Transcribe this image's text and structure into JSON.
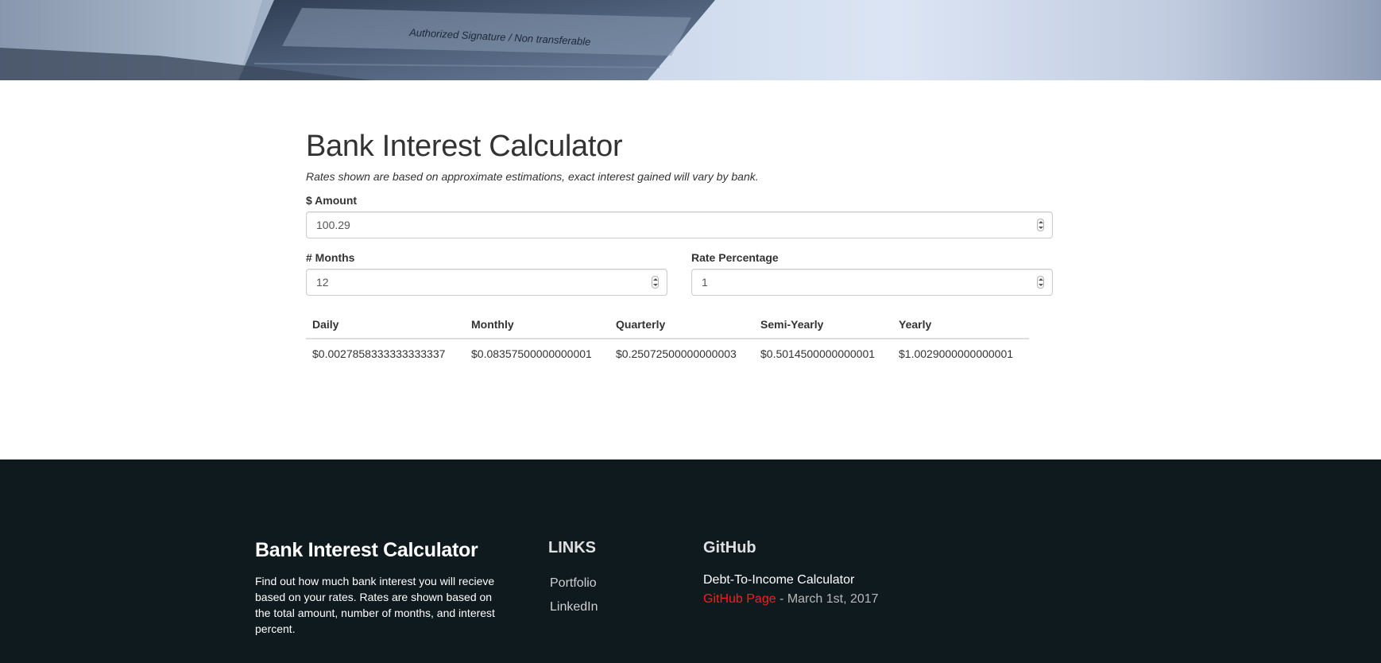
{
  "hero": {
    "card_text": "Authorized Signature / Non transferable"
  },
  "main": {
    "title": "Bank Interest Calculator",
    "subtitle": "Rates shown are based on approximate estimations, exact interest gained will vary by bank.",
    "amount": {
      "label": "$ Amount",
      "value": "100.29"
    },
    "months": {
      "label": "# Months",
      "value": "12"
    },
    "rate": {
      "label": "Rate Percentage",
      "value": "1"
    },
    "table": {
      "headers": [
        "Daily",
        "Monthly",
        "Quarterly",
        "Semi-Yearly",
        "Yearly"
      ],
      "values": [
        "$0.0027858333333333337",
        "$0.08357500000000001",
        "$0.25072500000000003",
        "$0.5014500000000001",
        "$1.0029000000000001"
      ]
    }
  },
  "footer": {
    "about": {
      "title": "Bank Interest Calculator",
      "description": "Find out how much bank interest you will recieve based on your rates. Rates are shown based on the total amount, number of months, and interest percent."
    },
    "links": {
      "heading": "LINKS",
      "items": [
        "Portfolio",
        "LinkedIn"
      ]
    },
    "github": {
      "heading": "GitHub",
      "project": "Debt-To-Income Calculator",
      "link_label": "GitHub Page",
      "date": " - March 1st, 2017"
    }
  },
  "colors": {
    "footer_bg": "#0f1a1f",
    "link_red": "#ff1a1a",
    "text": "#333333"
  }
}
